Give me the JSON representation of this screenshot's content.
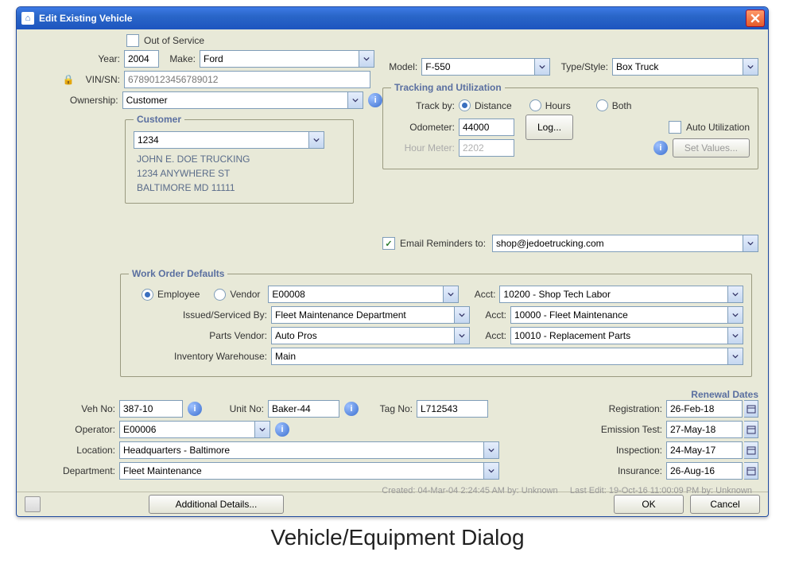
{
  "window": {
    "title": "Edit Existing Vehicle",
    "close": "X"
  },
  "out_of_service": {
    "label": "Out of Service",
    "checked": false
  },
  "top": {
    "year_label": "Year:",
    "year": "2004",
    "make_label": "Make:",
    "make": "Ford",
    "model_label": "Model:",
    "model": "F-550",
    "type_label": "Type/Style:",
    "type": "Box Truck",
    "vin_label": "VIN/SN:",
    "vin": "67890123456789012",
    "ownership_label": "Ownership:",
    "ownership": "Customer"
  },
  "customer": {
    "legend": "Customer",
    "number": "1234",
    "name": "JOHN E. DOE TRUCKING",
    "addr1": "1234 ANYWHERE ST",
    "addr2": "BALTIMORE MD 11111"
  },
  "tracking": {
    "legend": "Tracking and Utilization",
    "track_by_label": "Track by:",
    "opts": {
      "distance": "Distance",
      "hours": "Hours",
      "both": "Both"
    },
    "selected": "distance",
    "odometer_label": "Odometer:",
    "odometer": "44000",
    "hour_label": "Hour Meter:",
    "hour": "2202",
    "log_btn": "Log...",
    "auto_label": "Auto Utilization",
    "auto_checked": false,
    "set_values_btn": "Set Values..."
  },
  "email": {
    "label": "Email Reminders to:",
    "checked": true,
    "value": "shop@jedoetrucking.com"
  },
  "wod": {
    "legend": "Work Order Defaults",
    "radio_employee": "Employee",
    "radio_vendor": "Vendor",
    "radio_selected": "employee",
    "employee_id": "E00008",
    "issued_label": "Issued/Serviced By:",
    "issued": "Fleet Maintenance Department",
    "parts_label": "Parts Vendor:",
    "parts": "Auto Pros",
    "inv_label": "Inventory Warehouse:",
    "inv": "Main",
    "acct_label": "Acct:",
    "acct1": "10200 - Shop Tech Labor",
    "acct2": "10000 - Fleet Maintenance",
    "acct3": "10010 - Replacement Parts"
  },
  "lower": {
    "veh_label": "Veh No:",
    "veh": "387-10",
    "unit_label": "Unit No:",
    "unit": "Baker-44",
    "tag_label": "Tag No:",
    "tag": "L712543",
    "operator_label": "Operator:",
    "operator": "E00006",
    "location_label": "Location:",
    "location": "Headquarters - Baltimore",
    "department_label": "Department:",
    "department": "Fleet Maintenance"
  },
  "renewal": {
    "header": "Renewal Dates",
    "registration_label": "Registration:",
    "registration": "26-Feb-18",
    "emission_label": "Emission Test:",
    "emission": "27-May-18",
    "inspection_label": "Inspection:",
    "inspection": "24-May-17",
    "insurance_label": "Insurance:",
    "insurance": "26-Aug-16"
  },
  "audit": {
    "created": "Created: 04-Mar-04 2:24:45 AM by: Unknown",
    "last": "Last Edit: 19-Oct-16 11:00:09 PM by: Unknown"
  },
  "buttons": {
    "additional": "Additional Details...",
    "ok": "OK",
    "cancel": "Cancel"
  },
  "caption": "Vehicle/Equipment Dialog"
}
